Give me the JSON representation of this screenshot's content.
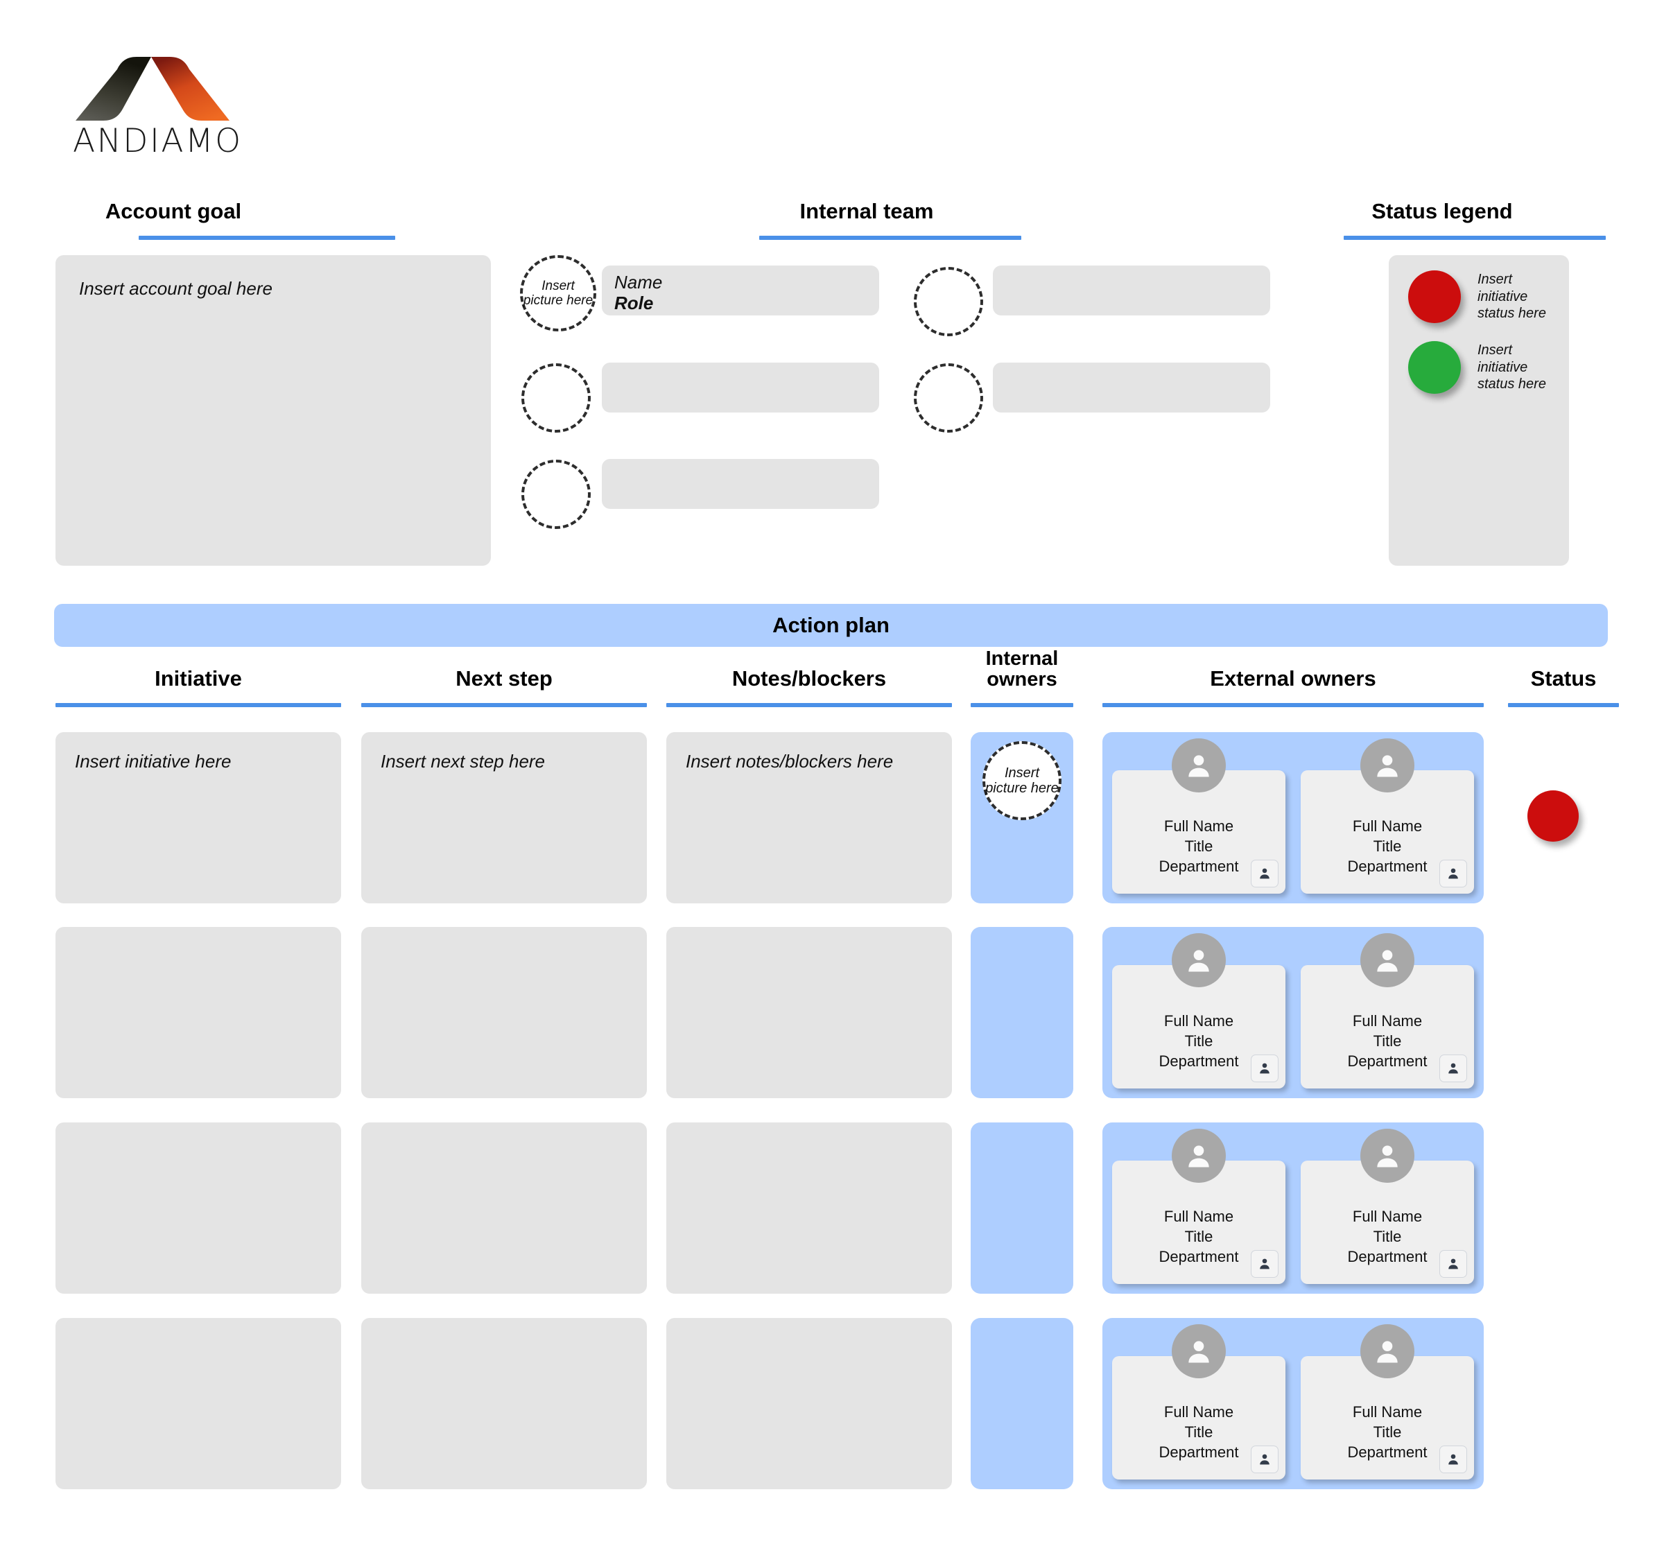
{
  "brand": {
    "name": "ANDIAMO",
    "logo_icon": "andiamo-a-logo"
  },
  "colors": {
    "accent_blue": "#4a90e8",
    "panel_blue": "#aeceff",
    "box_gray": "#e4e4e4",
    "status_red": "#cc0d0d",
    "status_green": "#27ab3c",
    "logo_orange": "#e8601f",
    "logo_dark": "#3d3d33"
  },
  "account_goal": {
    "heading": "Account goal",
    "placeholder": "Insert account goal here"
  },
  "internal_team": {
    "heading": "Internal team",
    "picture_placeholder": "Insert picture here",
    "members": [
      {
        "picture_placeholder": "Insert picture here",
        "name": "Name",
        "role": "Role",
        "filled": true
      },
      {
        "picture_placeholder": "",
        "name": "",
        "role": "",
        "filled": false
      },
      {
        "picture_placeholder": "",
        "name": "",
        "role": "",
        "filled": false
      },
      {
        "picture_placeholder": "",
        "name": "",
        "role": "",
        "filled": false
      },
      {
        "picture_placeholder": "",
        "name": "",
        "role": "",
        "filled": false
      }
    ]
  },
  "status_legend": {
    "heading": "Status legend",
    "items": [
      {
        "color": "#cc0d0d",
        "label": "Insert initiative status here",
        "icon": "red-status-dot"
      },
      {
        "color": "#27ab3c",
        "label": "Insert initiative status here",
        "icon": "green-status-dot"
      }
    ]
  },
  "action_plan": {
    "banner_title": "Action plan",
    "columns": [
      "Initiative",
      "Next step",
      "Notes/blockers",
      "Internal owners",
      "External owners",
      "Status"
    ],
    "owner_card": {
      "full_name": "Full Name",
      "title": "Title",
      "department": "Department",
      "avatar_icon": "person-avatar-icon",
      "badge_icon": "person-badge-icon"
    },
    "internal_owner_picture_placeholder": "Insert picture here",
    "rows": [
      {
        "initiative": "Insert initiative here",
        "next_step": "Insert next step here",
        "notes": "Insert notes/blockers here",
        "internal_owner_placeholder": "Insert picture here",
        "status_color": "#cc0d0d",
        "has_status": true
      },
      {
        "initiative": "",
        "next_step": "",
        "notes": "",
        "internal_owner_placeholder": "",
        "status_color": "",
        "has_status": false
      },
      {
        "initiative": "",
        "next_step": "",
        "notes": "",
        "internal_owner_placeholder": "",
        "status_color": "",
        "has_status": false
      },
      {
        "initiative": "",
        "next_step": "",
        "notes": "",
        "internal_owner_placeholder": "",
        "status_color": "",
        "has_status": false
      }
    ]
  }
}
